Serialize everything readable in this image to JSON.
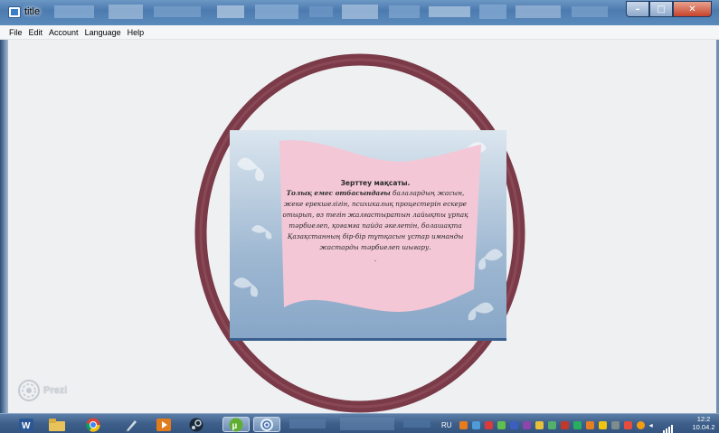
{
  "window": {
    "title": "title",
    "controls": {
      "minimize": "–",
      "maximize": "□",
      "close": "✕"
    }
  },
  "menu": [
    "File",
    "Edit",
    "Account",
    "Language",
    "Help"
  ],
  "slide": {
    "heading": "Зерттеу мақсаты.",
    "body_bold": "Толық емес отбасындағы",
    "body": " балалардың жасын, жеке ерекшелігін, психикалық процестерін ескере отырып, өз тегін жалғастыратын лайықты ұрпақ тәрбиелеп, қоғамға пайда әкелетін, болашақта Қазақстанның бір-бір тұтқасын ұстар имнанды жастарды тәрбиелеп шығару.",
    "trailing": ".",
    "colors": {
      "ring": "#7a3a48",
      "banner": "#f3c7d6",
      "background": "#9fb8d2"
    }
  },
  "brand": {
    "name": "Prezi"
  },
  "taskbar": {
    "apps": [
      "word-icon",
      "file-explorer-icon",
      "chrome-icon",
      "pen-icon",
      "media-player-icon",
      "steam-icon",
      "pen-tool-icon",
      "utorrent-icon",
      "prezi-icon"
    ],
    "language": "RU",
    "time": "12:2",
    "date": "10.04.2"
  }
}
